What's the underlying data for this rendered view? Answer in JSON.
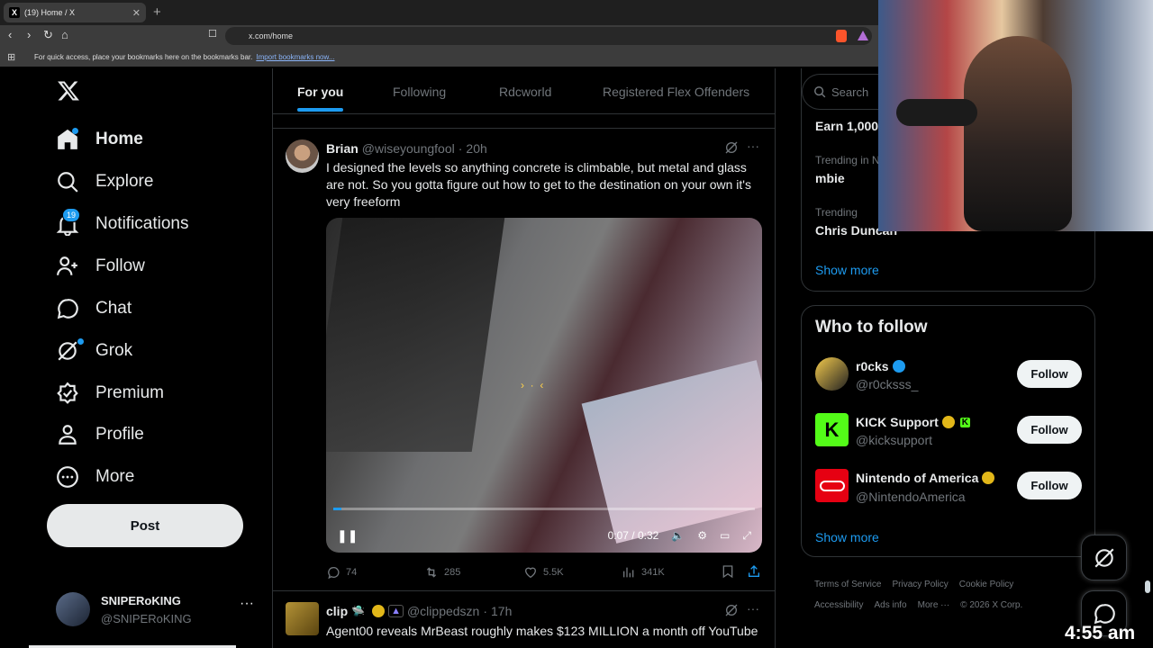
{
  "browser": {
    "tab_title": "(19) Home / X",
    "url": "x.com/home",
    "bookmarks_hint": "For quick access, place your bookmarks here on the bookmarks bar.",
    "bookmarks_import": "Import bookmarks now..."
  },
  "nav": {
    "items": [
      {
        "label": "Home",
        "icon": "home-icon"
      },
      {
        "label": "Explore",
        "icon": "search-icon"
      },
      {
        "label": "Notifications",
        "icon": "bell-icon"
      },
      {
        "label": "Follow",
        "icon": "follow-icon"
      },
      {
        "label": "Chat",
        "icon": "chat-icon"
      },
      {
        "label": "Grok",
        "icon": "grok-icon"
      },
      {
        "label": "Premium",
        "icon": "premium-icon"
      },
      {
        "label": "Profile",
        "icon": "profile-icon"
      },
      {
        "label": "More",
        "icon": "more-icon"
      }
    ],
    "notif_count": "19",
    "post_label": "Post",
    "account_name": "SNIPERoKING",
    "account_handle": "@SNIPERoKING"
  },
  "timeline": {
    "tabs": [
      "For you",
      "Following",
      "Rdcworld",
      "Registered Flex Offenders"
    ],
    "tweet1": {
      "name": "Brian",
      "handle": "@wiseyoungfool",
      "time": "20h",
      "text": "I designed the levels so anything concrete is climbable, but metal and glass are not. So you gotta figure out how to get to the destination on your own it's very freeform",
      "video_time": "0:07 / 0:32",
      "video_progress": 0.02,
      "replies": "74",
      "reposts": "285",
      "likes": "5.5K",
      "views": "341K"
    },
    "tweet2": {
      "name": "clip",
      "handle": "@clippedszn",
      "time": "17h",
      "text": "Agent00 reveals MrBeast roughly makes $123 MILLION a month off YouTube"
    }
  },
  "sidebar": {
    "search_placeholder": "Search",
    "trends": [
      {
        "meta": "",
        "name": "Earn 1,000"
      },
      {
        "meta": "Trending in N",
        "name": "mbie"
      },
      {
        "meta": "Trending",
        "name": "Chris Duncan"
      }
    ],
    "trends_show_more": "Show more",
    "who_to_follow_title": "Who to follow",
    "follow_suggestions": [
      {
        "name": "r0cks",
        "handle": "@r0cksss_",
        "badge": "#1d9bf0"
      },
      {
        "name": "KICK Support",
        "handle": "@kicksupport",
        "badge": "#e2b719"
      },
      {
        "name": "Nintendo of America",
        "handle": "@NintendoAmerica",
        "badge": "#e2b719"
      }
    ],
    "follow_label": "Follow",
    "follow_show_more": "Show more",
    "footer": [
      "Terms of Service",
      "Privacy Policy",
      "Cookie Policy",
      "Accessibility",
      "Ads info",
      "More ···",
      "© 2026 X Corp."
    ]
  },
  "overlay": {
    "clock": "4:55 am"
  },
  "colors": {
    "accent": "#1d9bf0",
    "bg": "#000000",
    "muted": "#71767b"
  }
}
